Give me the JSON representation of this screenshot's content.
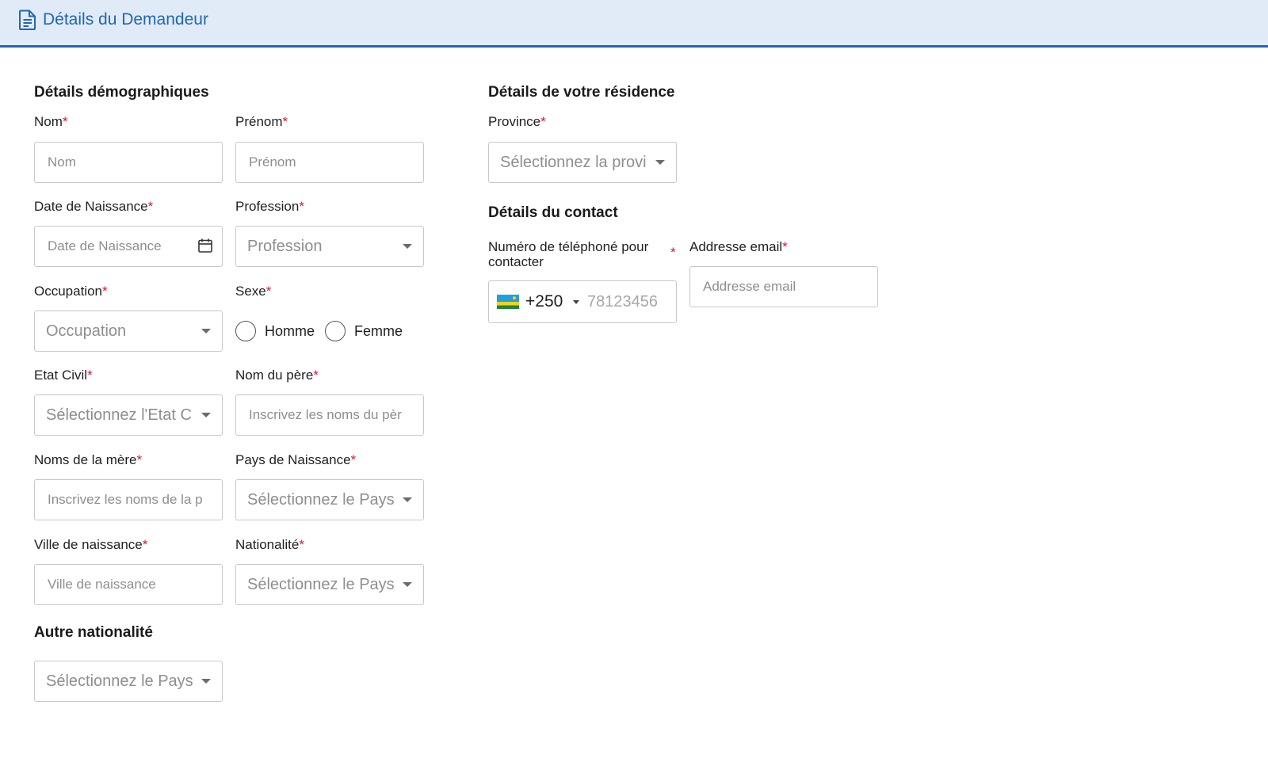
{
  "header": {
    "title": "Détails du Demandeur",
    "icon": "document-icon"
  },
  "colors": {
    "accent": "#1f66b8",
    "header_bg": "#e1ebf7",
    "required": "#e0142d"
  },
  "required_mark": "*",
  "demographics": {
    "title": "Détails démographiques",
    "nom": {
      "label": "Nom",
      "placeholder": "Nom"
    },
    "prenom": {
      "label": "Prénom",
      "placeholder": "Prénom"
    },
    "date_naissance": {
      "label": "Date de Naissance",
      "placeholder": "Date de Naissance"
    },
    "profession": {
      "label": "Profession",
      "placeholder": "Profession"
    },
    "occupation": {
      "label": "Occupation",
      "placeholder": "Occupation"
    },
    "sexe": {
      "label": "Sexe",
      "options": [
        "Homme",
        "Femme"
      ]
    },
    "etat_civil": {
      "label": "Etat Civil",
      "placeholder": "Sélectionnez l'Etat C"
    },
    "nom_pere": {
      "label": "Nom du père",
      "placeholder": "Inscrivez les noms du pèr"
    },
    "noms_mere": {
      "label": "Noms de la mère",
      "placeholder": "Inscrivez les noms de la p"
    },
    "pays_naissance": {
      "label": "Pays de Naissance",
      "placeholder": "Sélectionnez le Pays"
    },
    "ville_naissance": {
      "label": "Ville de naissance",
      "placeholder": "Ville de naissance"
    },
    "nationalite": {
      "label": "Nationalité",
      "placeholder": "Sélectionnez le Pays"
    }
  },
  "autre_nationalite": {
    "title": "Autre nationalité",
    "placeholder": "Sélectionnez le Pays"
  },
  "residence": {
    "title": "Détails de votre résidence",
    "province": {
      "label": "Province",
      "placeholder": "Sélectionnez la provi"
    }
  },
  "contact": {
    "title": "Détails du contact",
    "phone": {
      "label_line1": "Numéro de téléphoné pour",
      "label_line2": "contacter",
      "dial_code": "+250",
      "placeholder": "78123456",
      "flag": "rwanda-flag-icon"
    },
    "email": {
      "label": "Addresse email",
      "placeholder": "Addresse email"
    }
  }
}
